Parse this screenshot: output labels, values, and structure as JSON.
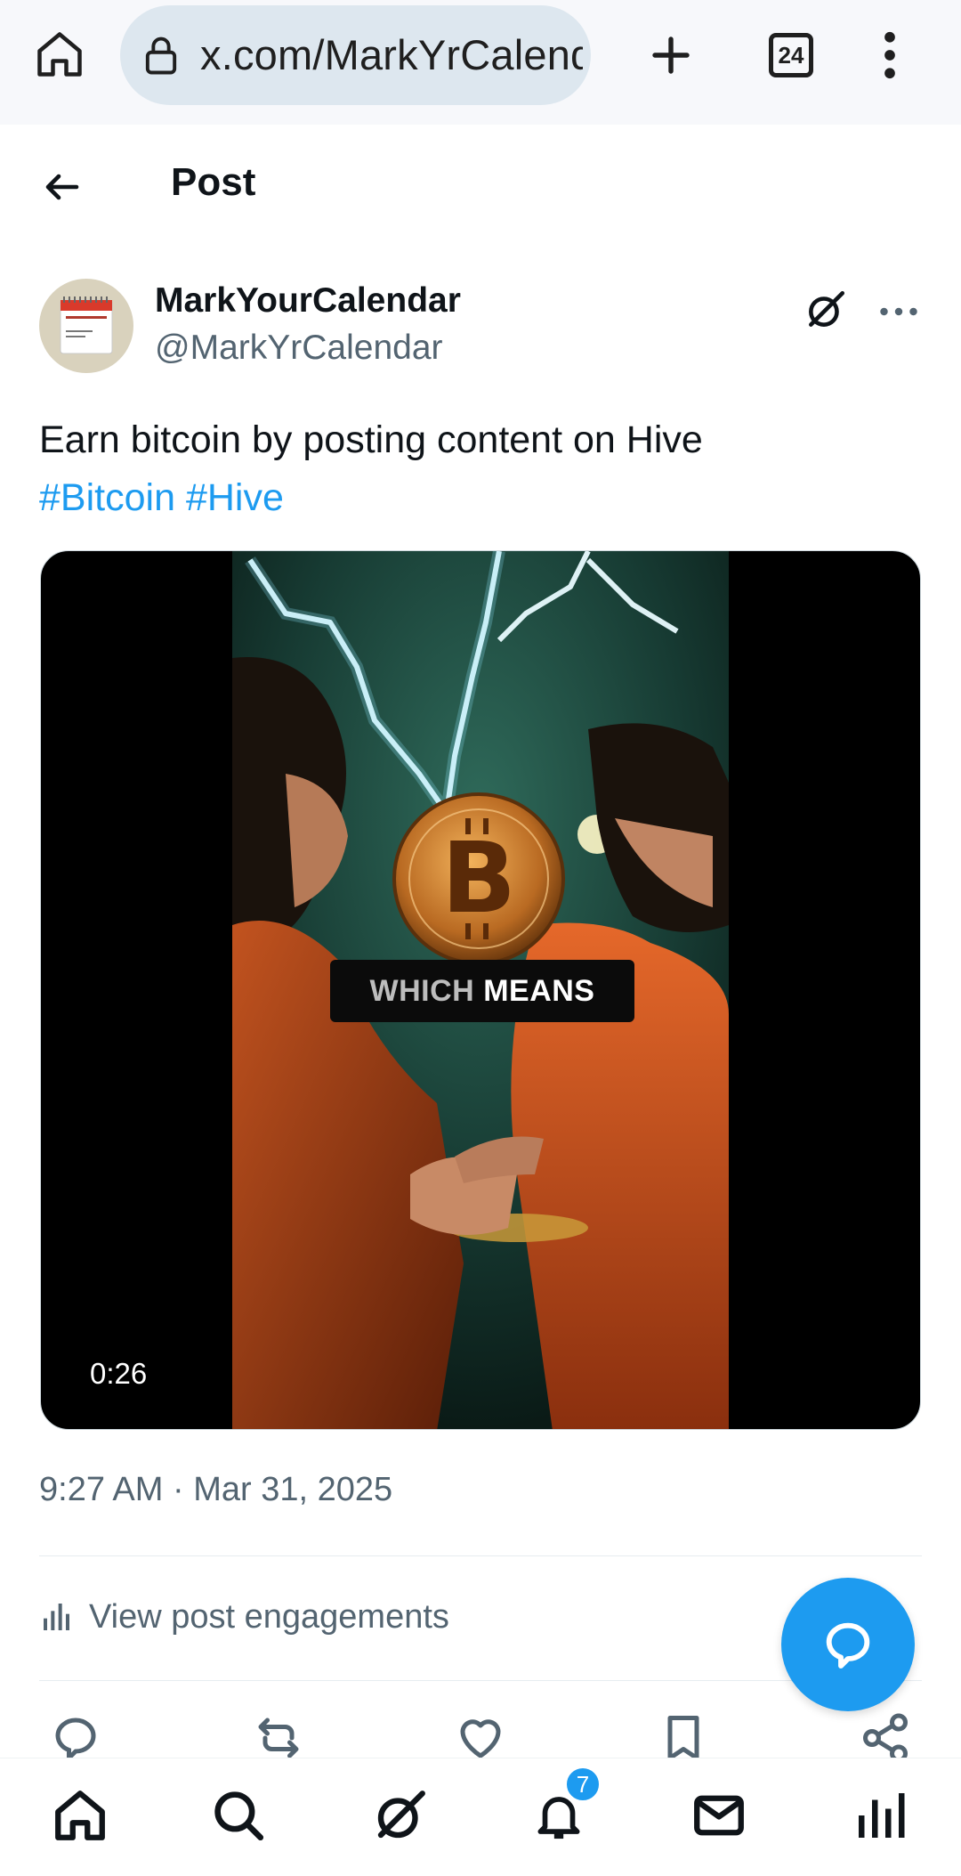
{
  "browser": {
    "url": "x.com/MarkYrCalendar",
    "tab_count": "24"
  },
  "header": {
    "title": "Post"
  },
  "post": {
    "author_name": "MarkYourCalendar",
    "author_handle": "@MarkYrCalendar",
    "text": "Earn bitcoin by posting content on Hive",
    "hashtags": [
      "#Bitcoin",
      "#Hive"
    ],
    "media": {
      "caption_word_1": "WHICH",
      "caption_word_2": "MEANS",
      "duration": "0:26"
    },
    "timestamp": "9:27 AM · Mar 31, 2025",
    "engagements_label": "View post engagements"
  },
  "nav": {
    "notifications_badge": "7"
  },
  "colors": {
    "accent": "#1d9bf0",
    "secondary_text": "#536471",
    "url_pill": "#dde7ef"
  },
  "icons": {
    "home": "home-icon",
    "lock": "lock-icon",
    "new_tab": "plus-icon",
    "menu": "more-vertical-icon",
    "back": "back-arrow-icon",
    "grok": "grok-icon",
    "more": "more-horizontal-icon",
    "reply": "reply-icon",
    "repost": "repost-icon",
    "like": "heart-icon",
    "bookmark": "bookmark-icon",
    "share": "share-icon",
    "fab": "compose-reply-icon",
    "search": "search-icon",
    "notifications": "bell-icon",
    "messages": "mail-icon",
    "analytics": "bar-chart-icon"
  }
}
